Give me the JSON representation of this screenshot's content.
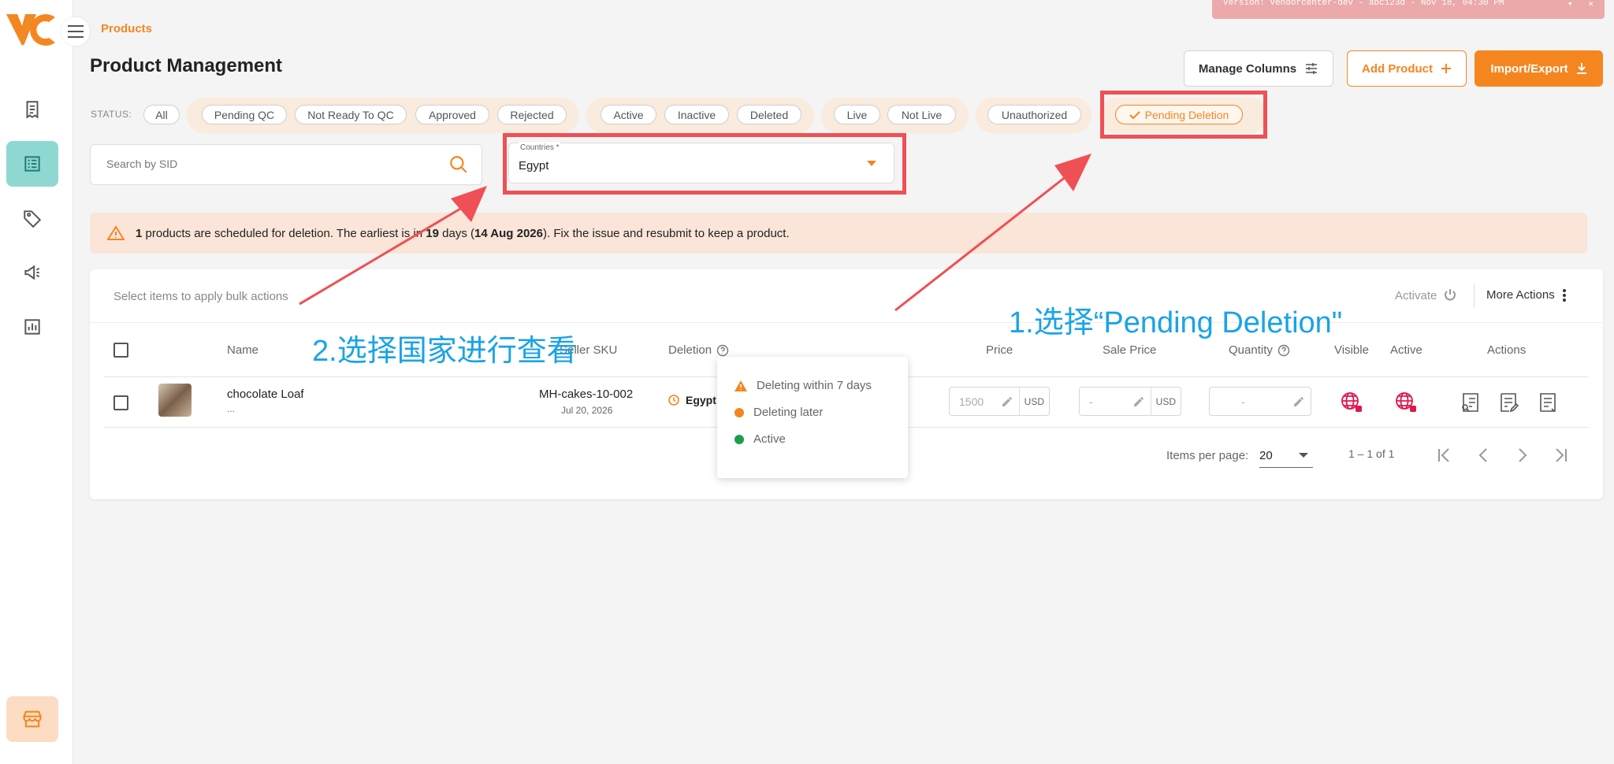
{
  "breadcrumb": "Products",
  "version_banner": {
    "text": "Version: vendorcenter-dev - abc123d - Nov 18, 04:30 PM",
    "chevron": "▾",
    "close": "✕"
  },
  "page_title": "Product Management",
  "header_buttons": {
    "manage_columns": "Manage Columns",
    "add_product": "Add Product",
    "import_export": "Import/Export"
  },
  "status": {
    "label": "STATUS:",
    "all": "All",
    "qc_group": [
      "Pending QC",
      "Not Ready To QC",
      "Approved",
      "Rejected"
    ],
    "state_group": [
      "Active",
      "Inactive",
      "Deleted"
    ],
    "live_group": [
      "Live",
      "Not Live"
    ],
    "auth_group": [
      "Unauthorized"
    ],
    "selected": "Pending Deletion"
  },
  "search": {
    "placeholder": "Search by SID"
  },
  "country_select": {
    "label": "Countries *",
    "value": "Egypt"
  },
  "alert": {
    "count": "1",
    "text1": " products are scheduled for deletion. The earliest is in ",
    "days": "19",
    "text2": " days (",
    "date": "14 Aug 2026",
    "text3": "). Fix the issue and resubmit to keep a product."
  },
  "bulk": {
    "hint": "Select items to apply bulk actions",
    "activate": "Activate",
    "more_actions": "More Actions"
  },
  "columns": {
    "name": "Name",
    "seller_sku": "Seller SKU",
    "deletion": "Deletion",
    "price": "Price",
    "sale_price": "Sale Price",
    "quantity": "Quantity",
    "visible": "Visible",
    "active": "Active",
    "actions": "Actions"
  },
  "row": {
    "name": "chocolate Loaf",
    "name_sub": "...",
    "sku": "MH-cakes-10-002",
    "date": "Jul 20, 2026",
    "deletion_country": "Egypt",
    "price": "1500",
    "price_unit": "USD",
    "sale_price": "-",
    "sale_unit": "USD",
    "quantity": "-"
  },
  "pagination": {
    "items_per_page_label": "Items per page:",
    "items_per_page": "20",
    "range": "1 – 1 of 1"
  },
  "tooltip": {
    "items": [
      "Deleting within 7 days",
      "Deleting later",
      "Active"
    ]
  },
  "annotations": {
    "step1": "1.选择“Pending Deletion\"",
    "step2": "2.选择国家进行查看"
  },
  "colors": {
    "accent": "#f5861f",
    "teal": "#8fd8d2",
    "annotation_red": "#ef5055",
    "annotation_blue": "#19a3e8",
    "active_green": "#1e9e4a",
    "globe_red": "#e0174d"
  }
}
